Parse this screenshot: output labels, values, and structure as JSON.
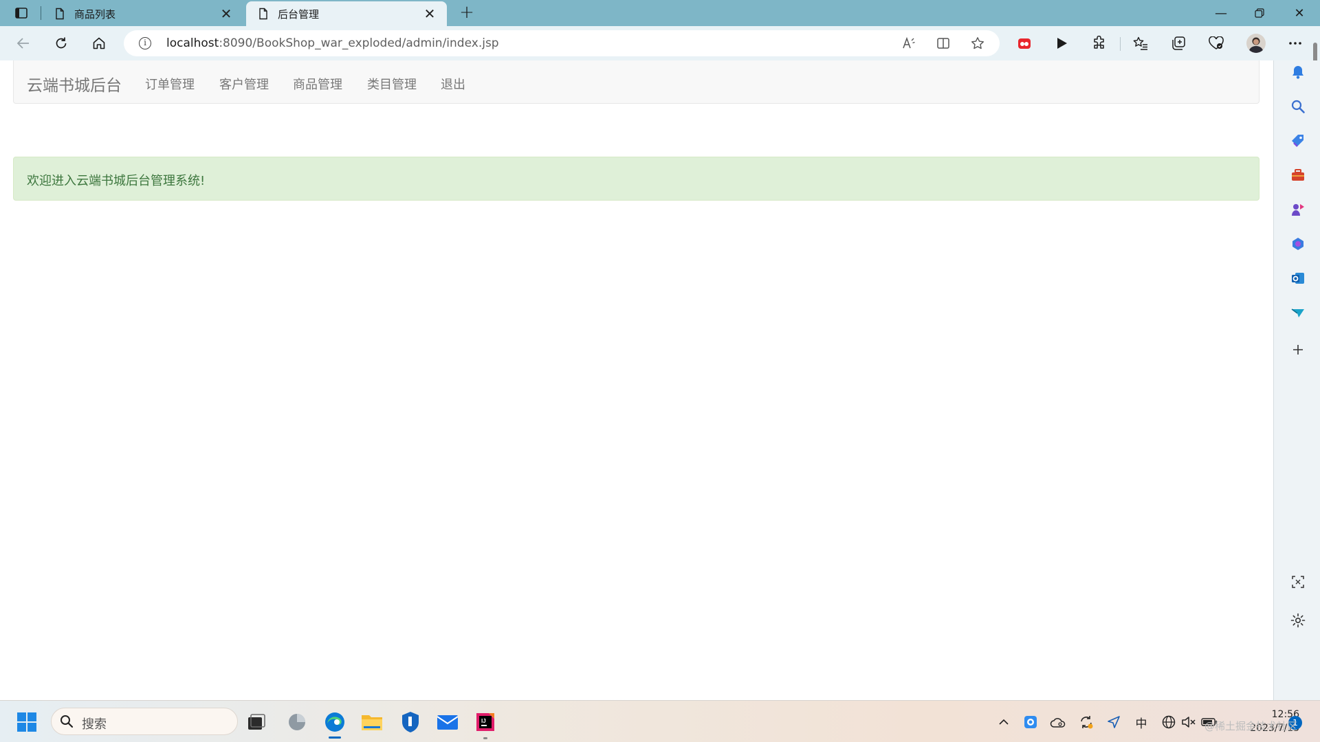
{
  "browser": {
    "tabs": [
      {
        "title": "商品列表",
        "active": false
      },
      {
        "title": "后台管理",
        "active": true
      }
    ],
    "url_host": "localhost",
    "url_rest": ":8090/BookShop_war_exploded/admin/index.jsp",
    "icons": [
      "sidebar-toggle-icon",
      "page-icon",
      "close-icon",
      "plus-icon",
      "back-icon",
      "refresh-icon",
      "home-icon",
      "info-icon",
      "read-aloud-icon",
      "split-screen-icon",
      "favorite-icon",
      "extension-icon",
      "play-icon",
      "puzzle-icon",
      "favorites-icon",
      "collections-icon",
      "performance-icon",
      "profile-avatar",
      "more-icon"
    ]
  },
  "site": {
    "brand": "云端书城后台",
    "nav": [
      "订单管理",
      "客户管理",
      "商品管理",
      "类目管理",
      "退出"
    ],
    "welcome": "欢迎进入云端书城后台管理系统!"
  },
  "sidebar": {
    "icons": [
      "bell-icon",
      "search-icon",
      "tag-icon",
      "toolbox-icon",
      "games-icon",
      "copilot-icon",
      "outlook-icon",
      "send-icon",
      "add-icon",
      "screenshot-icon",
      "settings-icon"
    ]
  },
  "taskbar": {
    "search_placeholder": "搜索",
    "ime": "中",
    "time": "12:56",
    "date": "2023/7/13",
    "notification_count": "1",
    "watermark": "@稀土掘金技术社区"
  },
  "colors": {
    "tabstrip": "#7eb6c7",
    "toolbar": "#e9f2f6",
    "navbar_bg": "#f8f8f8",
    "alert_bg": "#dff0d8",
    "alert_text": "#3c763d"
  }
}
